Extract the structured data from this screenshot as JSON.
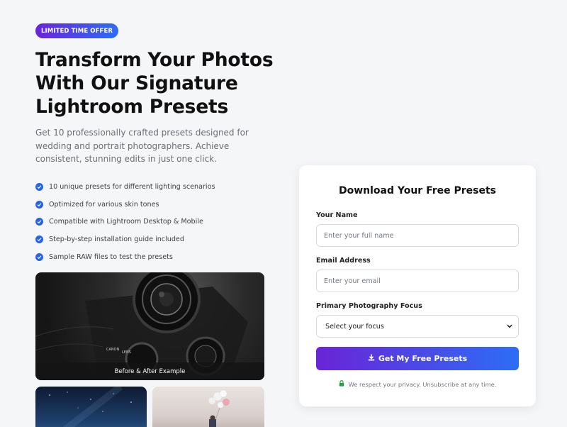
{
  "badge": "LIMITED TIME OFFER",
  "headline": [
    "Transform Your Photos",
    "With Our Signature",
    "Lightroom Presets"
  ],
  "subtext": "Get 10 professionally crafted presets designed for wedding and portrait photographers. Achieve consistent, stunning edits in just one click.",
  "features": [
    "10 unique presets for different lighting scenarios",
    "Optimized for various skin tones",
    "Compatible with Lightroom Desktop & Mobile",
    "Step-by-step installation guide included",
    "Sample RAW files to test the presets"
  ],
  "gallery": {
    "caption": "Before & After Example"
  },
  "form": {
    "title": "Download Your Free Presets",
    "name_label": "Your Name",
    "name_placeholder": "Enter your full name",
    "email_label": "Email Address",
    "email_placeholder": "Enter your email",
    "focus_label": "Primary Photography Focus",
    "focus_selected": "Select your focus",
    "submit_label": "Get My Free Presets",
    "privacy_note": "We respect your privacy. Unsubscribe at any time."
  },
  "colors": {
    "accent_start": "#6a24d6",
    "accent_end": "#2d6df6",
    "check": "#2563eb",
    "lock": "#22a04b"
  }
}
